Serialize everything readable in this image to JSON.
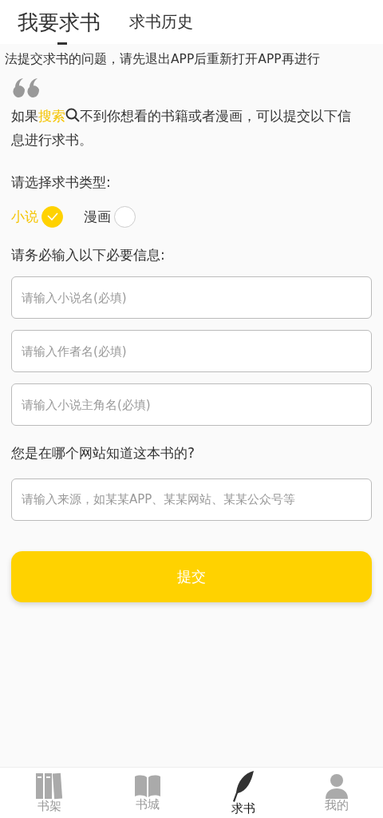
{
  "tabs": [
    {
      "label": "我要求书",
      "selected": true
    },
    {
      "label": "求书历史",
      "selected": false
    }
  ],
  "notice": "法提交求书的问题，请先退出APP后重新打开APP再进行",
  "intro": {
    "before": "如果",
    "link": "搜索",
    "after": "不到你想看的书籍或者漫画，可以提交以下信息进行求书。"
  },
  "type_label": "请选择求书类型:",
  "types": [
    {
      "label": "小说",
      "selected": true
    },
    {
      "label": "漫画",
      "selected": false
    }
  ],
  "required_label": "请务必输入以下必要信息:",
  "required_fields": [
    {
      "placeholder": "请输入小说名(必填)"
    },
    {
      "placeholder": "请输入作者名(必填)"
    },
    {
      "placeholder": "请输入小说主角名(必填)"
    }
  ],
  "source_label": "您是在哪个网站知道这本书的?",
  "source_field": {
    "placeholder": "请输入来源，如某某APP、某某网站、某某公众号等"
  },
  "submit": "提交",
  "bottom_nav": [
    {
      "label": "书架",
      "kind": "shelf",
      "selected": false
    },
    {
      "label": "书城",
      "kind": "book",
      "selected": false
    },
    {
      "label": "求书",
      "kind": "quill",
      "selected": true
    },
    {
      "label": "我的",
      "kind": "person",
      "selected": false
    }
  ]
}
